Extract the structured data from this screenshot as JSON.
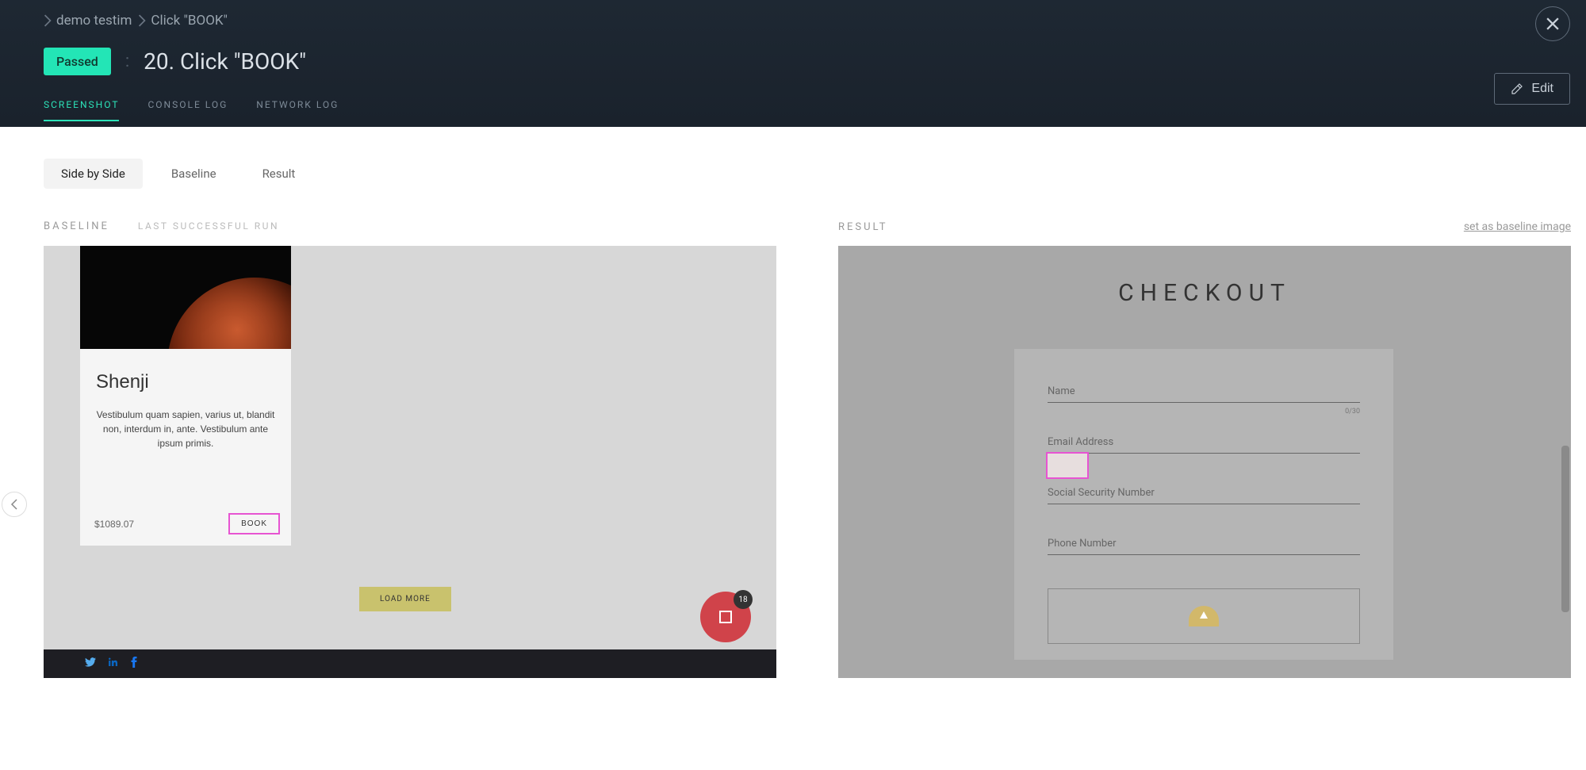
{
  "breadcrumb": {
    "item1": "demo testim",
    "item2": "Click \"BOOK\""
  },
  "status": {
    "label": "Passed"
  },
  "step": {
    "number_title": "20. Click \"BOOK\""
  },
  "buttons": {
    "edit": "Edit"
  },
  "tabs": {
    "main": {
      "screenshot": "Screenshot",
      "console_log": "Console Log",
      "network_log": "Network Log"
    },
    "view": {
      "side_by_side": "Side by Side",
      "baseline": "Baseline",
      "result": "Result"
    }
  },
  "panels": {
    "baseline": {
      "label": "Baseline",
      "sub": "Last Successful Run"
    },
    "result": {
      "label": "Result",
      "set_baseline": "set as baseline image"
    }
  },
  "baseline_preview": {
    "card_title": "Shenji",
    "card_desc": "Vestibulum quam sapien, varius ut, blandit non, interdum in, ante. Vestibulum ante ipsum primis.",
    "price": "$1089.07",
    "book_btn": "BOOK",
    "load_more": "LOAD MORE",
    "cart_badge": "18"
  },
  "result_preview": {
    "title": "CHECKOUT",
    "fields": {
      "name": "Name",
      "name_counter": "0/30",
      "email": "Email Address",
      "ssn": "Social Security Number",
      "phone": "Phone Number"
    }
  }
}
